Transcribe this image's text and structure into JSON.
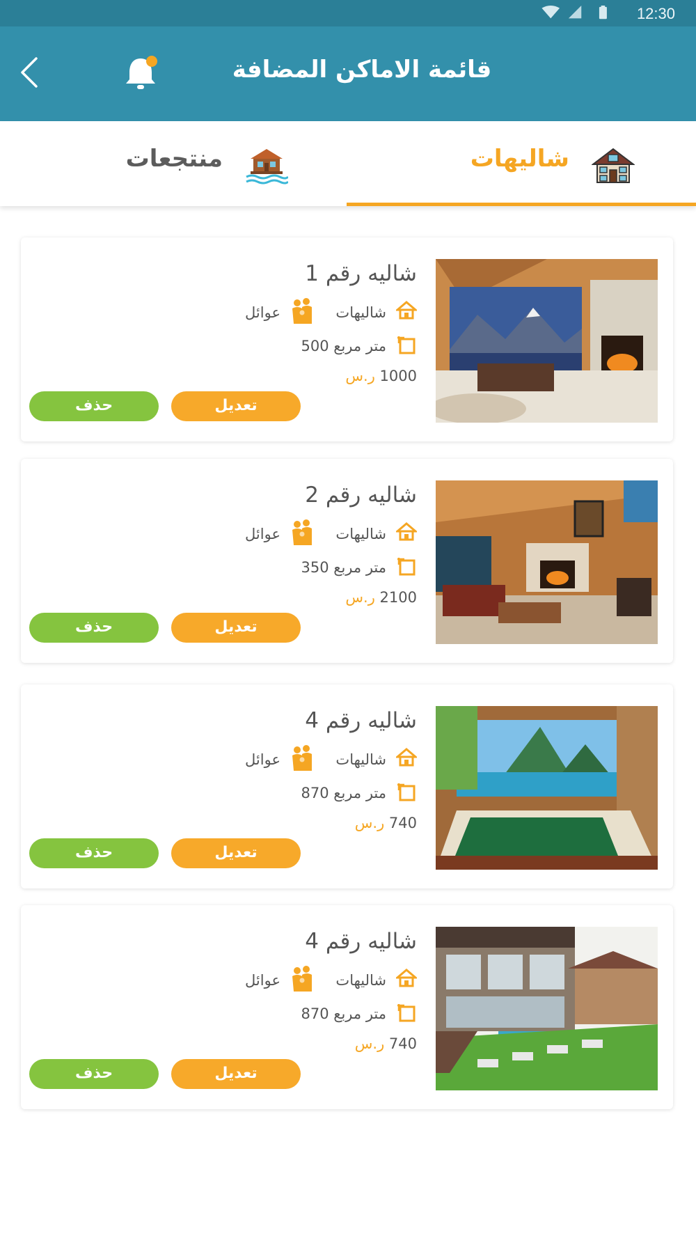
{
  "status_bar": {
    "time": "12:30"
  },
  "app_bar": {
    "title": "قائمة الاماكن المضافة"
  },
  "tabs": [
    {
      "label": "شاليهات",
      "icon": "chalet-house-icon",
      "active": true
    },
    {
      "label": "منتجعات",
      "icon": "resort-water-icon",
      "active": false
    }
  ],
  "colors": {
    "header": "#3390ab",
    "accent": "#f5a623",
    "delete": "#85c43f"
  },
  "cards": [
    {
      "title": "شاليه رقم 1",
      "type": "شاليهات",
      "audience": "عوائل",
      "area_value": "500",
      "area_unit": "متر مربع",
      "price": "1000",
      "currency": "ر.س",
      "edit_label": "تعديل",
      "delete_label": "حذف"
    },
    {
      "title": "شاليه رقم 2",
      "type": "شاليهات",
      "audience": "عوائل",
      "area_value": "350",
      "area_unit": "متر مربع",
      "price": "2100",
      "currency": "ر.س",
      "edit_label": "تعديل",
      "delete_label": "حذف"
    },
    {
      "title": "شاليه رقم 4",
      "type": "شاليهات",
      "audience": "عوائل",
      "area_value": "870",
      "area_unit": "متر مربع",
      "price": "740",
      "currency": "ر.س",
      "edit_label": "تعديل",
      "delete_label": "حذف"
    },
    {
      "title": "شاليه رقم 4",
      "type": "شاليهات",
      "audience": "عوائل",
      "area_value": "870",
      "area_unit": "متر مربع",
      "price": "740",
      "currency": "ر.س",
      "edit_label": "تعديل",
      "delete_label": "حذف"
    }
  ]
}
